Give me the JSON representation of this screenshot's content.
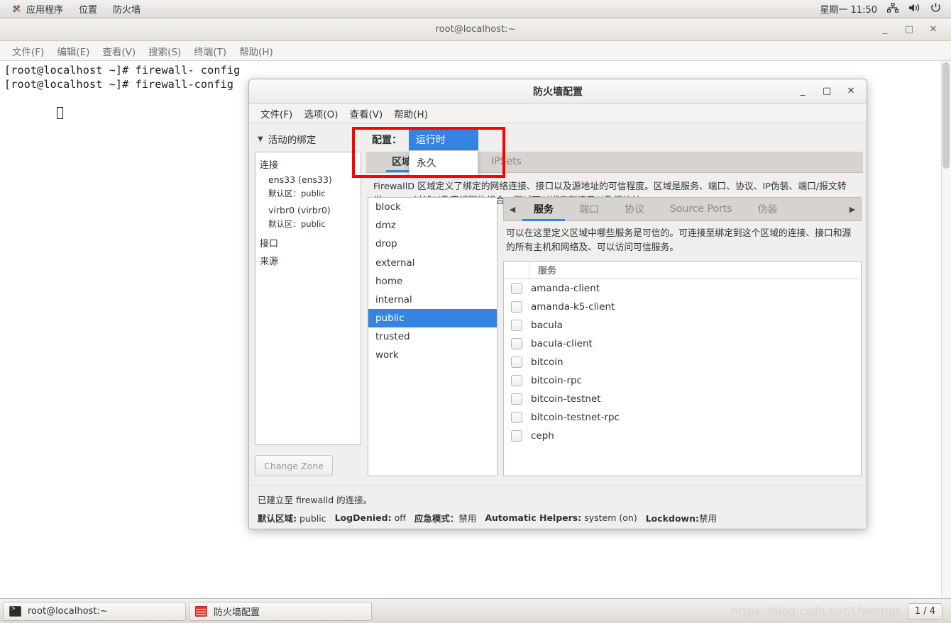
{
  "top_panel": {
    "apps_label": "应用程序",
    "places_label": "位置",
    "app_label": "防火墙",
    "clock": "星期一 11:50",
    "icons": [
      "network-icon",
      "volume-icon",
      "power-icon"
    ]
  },
  "terminal": {
    "title": "root@localhost:~",
    "window_buttons": {
      "minimize": "_",
      "maximize": "□",
      "close": "✕"
    },
    "menu": [
      "文件(F)",
      "编辑(E)",
      "查看(V)",
      "搜索(S)",
      "终端(T)",
      "帮助(H)"
    ],
    "lines": [
      "[root@localhost ~]# firewall- config",
      "[root@localhost ~]# firewall-config"
    ]
  },
  "firewall": {
    "title": "防火墙配置",
    "window_buttons": {
      "minimize": "_",
      "maximize": "□",
      "close": "✕"
    },
    "menu": [
      "文件(F)",
      "选项(O)",
      "查看(V)",
      "帮助(H)"
    ],
    "left": {
      "bindings_header": "活动的绑定",
      "chevron": "chevron-down-icon",
      "group_connections": "连接",
      "connections": [
        {
          "name": "ens33 (ens33)",
          "zone_label": "默认区：",
          "zone": "public"
        },
        {
          "name": "virbr0 (virbr0)",
          "zone_label": "默认区：",
          "zone": "public"
        }
      ],
      "group_interfaces": "接口",
      "group_sources": "来源",
      "change_zone_button": "Change Zone"
    },
    "config": {
      "label": "配置：",
      "selected": "运行时",
      "options": [
        "运行时",
        "永久"
      ]
    },
    "outer_tabs": [
      {
        "label": "区域",
        "active": true
      },
      {
        "label": "IPSets",
        "active": false
      }
    ],
    "zone_description": "FirewallD 区域定义了绑定的网络连接、接口以及源地址的可信程度。区域是服务、端口、协议、IP伪装、端口/报文转发、ICMP过滤以及富规则的组合。区域可以绑定到接口以及源地址。",
    "zones": [
      "block",
      "dmz",
      "drop",
      "external",
      "home",
      "internal",
      "public",
      "trusted",
      "work"
    ],
    "selected_zone": "public",
    "inner_tabs": [
      {
        "label": "服务",
        "active": true
      },
      {
        "label": "端口",
        "active": false
      },
      {
        "label": "协议",
        "active": false
      },
      {
        "label": "Source Ports",
        "active": false
      },
      {
        "label": "伪装",
        "active": false
      }
    ],
    "tab_scroll_left": "◀",
    "tab_scroll_right": "▶",
    "services_description": "可以在这里定义区域中哪些服务是可信的。可连接至绑定到这个区域的连接、接口和源的所有主机和网络及、可以访问可信服务。",
    "services_column_header": "服务",
    "services": [
      {
        "name": "amanda-client",
        "checked": false
      },
      {
        "name": "amanda-k5-client",
        "checked": false
      },
      {
        "name": "bacula",
        "checked": false
      },
      {
        "name": "bacula-client",
        "checked": false
      },
      {
        "name": "bitcoin",
        "checked": false
      },
      {
        "name": "bitcoin-rpc",
        "checked": false
      },
      {
        "name": "bitcoin-testnet",
        "checked": false
      },
      {
        "name": "bitcoin-testnet-rpc",
        "checked": false
      },
      {
        "name": "ceph",
        "checked": false
      }
    ],
    "status": {
      "connection_line": "已建立至 firewalld 的连接。",
      "default_zone_label": "默认区域:",
      "default_zone_value": "public",
      "logdenied_label": "LogDenied:",
      "logdenied_value": "off",
      "panic_label": "应急模式：",
      "panic_value": "禁用",
      "helpers_label": "Automatic Helpers:",
      "helpers_value": "system (on)",
      "lockdown_label": "Lockdown:",
      "lockdown_value": "禁用"
    }
  },
  "taskbar": {
    "items": [
      {
        "label": "root@localhost:~",
        "icon": "terminal-icon"
      },
      {
        "label": "防火墙配置",
        "icon": "firewall-icon"
      }
    ],
    "watermark": "https://blog.csdn.net/Lfwhqtpt",
    "workspace": "1 / 4"
  },
  "colors": {
    "accent": "#3584e4",
    "annotation": "#ff0000",
    "panel": "#f0efee"
  }
}
